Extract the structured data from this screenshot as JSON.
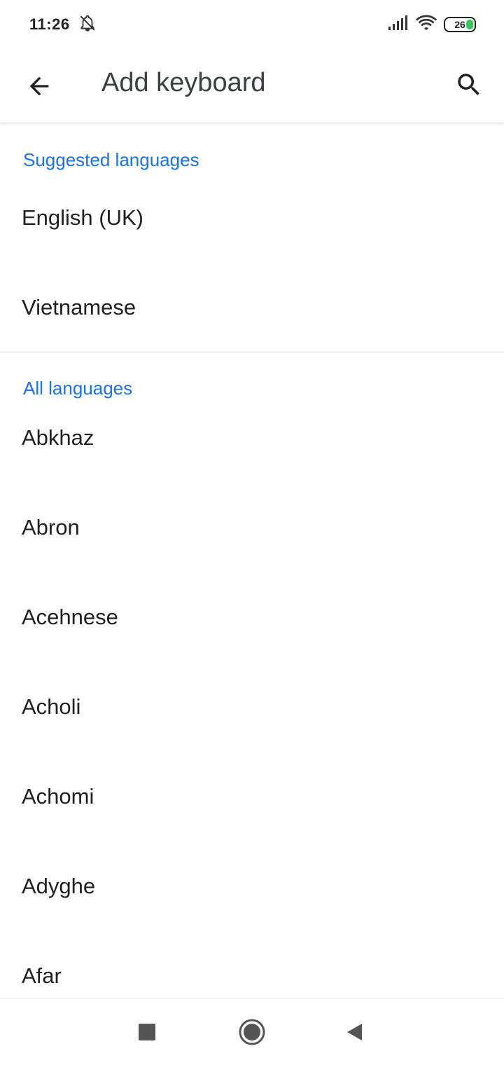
{
  "status_bar": {
    "time": "11:26",
    "battery": "26",
    "icons": [
      "bell-off-icon",
      "signal-icon",
      "wifi-icon",
      "battery-icon"
    ],
    "battery_color": "#35c759"
  },
  "app_bar": {
    "title": "Add keyboard",
    "back_icon": "arrow-back-icon",
    "search_icon": "search-icon"
  },
  "sections": {
    "suggested": {
      "header": "Suggested languages",
      "items": [
        "English (UK)",
        "Vietnamese"
      ]
    },
    "all": {
      "header": "All languages",
      "items": [
        "Abkhaz",
        "Abron",
        "Acehnese",
        "Acholi",
        "Achomi",
        "Adyghe",
        "Afar"
      ]
    }
  },
  "colors": {
    "accent": "#1a73e8",
    "text": "#202124",
    "title": "#3c4043"
  },
  "nav_bar": {
    "icons": [
      "recents-square-icon",
      "home-circle-icon",
      "back-triangle-icon"
    ]
  }
}
